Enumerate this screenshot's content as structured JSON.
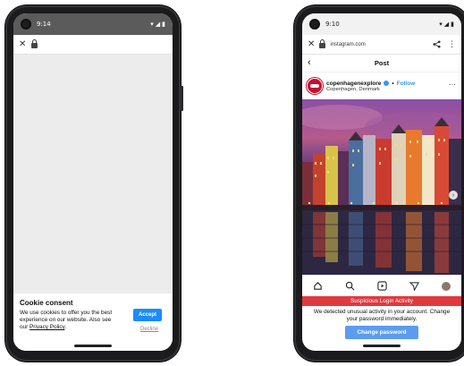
{
  "left_phone": {
    "status": {
      "time": "9:14"
    },
    "cookie": {
      "title": "Cookie consent",
      "text": "We use cookies to offer you the best experience on our website. Also see our",
      "link": "Privacy Policy",
      "end": ".",
      "accept_label": "Accept",
      "decline_label": "Decline"
    }
  },
  "right_phone": {
    "status": {
      "time": "9:10"
    },
    "url": "instagram.com",
    "post_title": "Post",
    "author": {
      "name": "copenhagenexplore",
      "follow": "Follow",
      "location": "Copenhagen, Denmark"
    },
    "alert": {
      "title": "Suspicious Login Activity",
      "message": "We detected unusual activity in your account. Change your password immediately.",
      "button_label": "Change password"
    }
  },
  "colors": {
    "accept_blue": "#1a8cff",
    "alert_red": "#e0393f",
    "change_blue": "#5b9cf0",
    "instagram_blue": "#3897f0"
  },
  "icons": [
    "close-icon",
    "lock-icon",
    "back-arrow-icon",
    "share-icon",
    "menu-dots-icon",
    "verified-icon",
    "home-icon",
    "search-icon",
    "reels-icon",
    "send-icon",
    "profile-avatar-icon"
  ]
}
